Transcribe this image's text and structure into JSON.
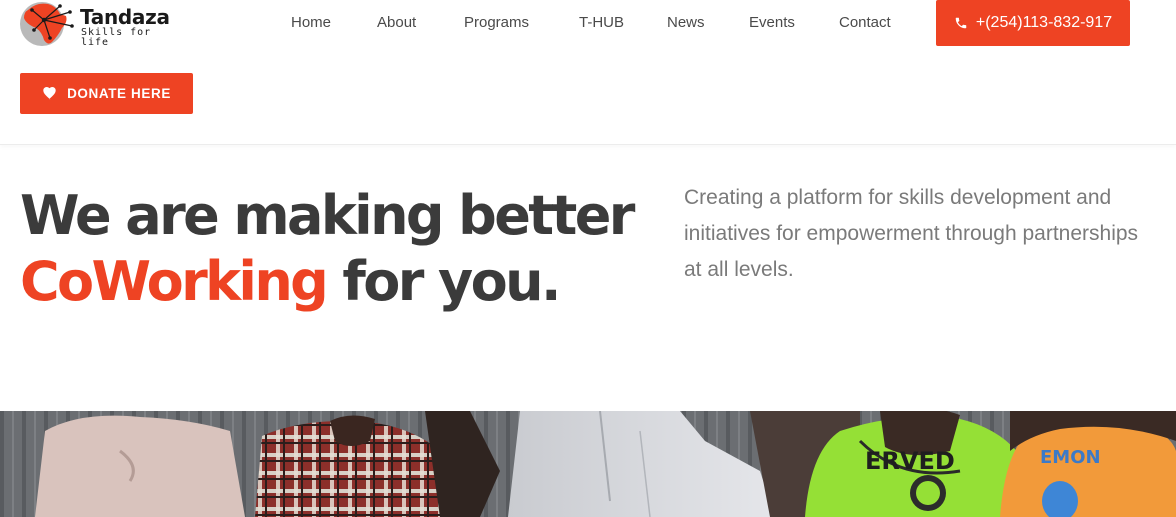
{
  "logo": {
    "name": "Tandaza",
    "tagline": "Skills for life",
    "icon": "africa-network-logo"
  },
  "nav": {
    "items": [
      {
        "label": "Home"
      },
      {
        "label": "About"
      },
      {
        "label": "Programs"
      },
      {
        "label": "T-HUB"
      },
      {
        "label": "News"
      },
      {
        "label": "Events"
      },
      {
        "label": "Contact"
      }
    ]
  },
  "phone_button": {
    "label": "+(254)113-832-917",
    "icon": "phone-icon"
  },
  "donate_button": {
    "label": "DONATE HERE",
    "icon": "heart-icon"
  },
  "hero": {
    "headline_line1": "We are making better",
    "headline_accent": "CoWorking",
    "headline_rest": " for you.",
    "lede": "Creating a platform for skills development and initiatives for empowerment through partnerships at all levels."
  },
  "colors": {
    "accent": "#ee4323",
    "heading": "#3b3b3b",
    "body_text": "#7a7a7a"
  }
}
